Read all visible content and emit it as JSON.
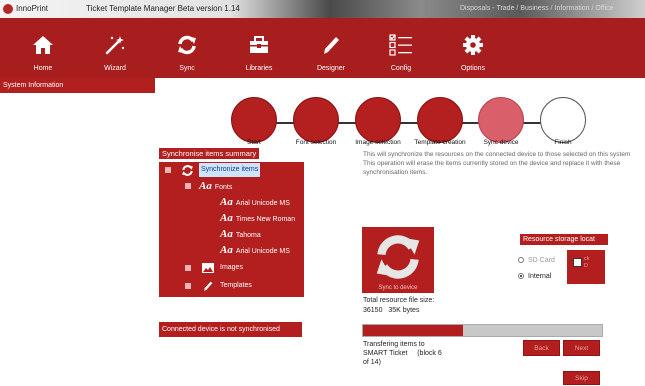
{
  "window": {
    "app_name": "InnoPrint",
    "title": "Ticket Template Manager Beta version 1.14",
    "blurred_right": "Disposals - Trade / Business / Information / Office"
  },
  "toolbar": {
    "items": [
      {
        "label": "Home",
        "icon": "home-icon"
      },
      {
        "label": "Wizard",
        "icon": "wand-icon"
      },
      {
        "label": "Sync",
        "icon": "sync-icon"
      },
      {
        "label": "Libraries",
        "icon": "toolbox-icon"
      },
      {
        "label": "Designer",
        "icon": "pen-icon"
      },
      {
        "label": "Config",
        "icon": "checklist-icon"
      },
      {
        "label": "Options",
        "icon": "gear-icon"
      }
    ]
  },
  "system_info": "System Information",
  "steps": [
    {
      "label": "Start",
      "state": "done"
    },
    {
      "label": "Font selection",
      "state": "done"
    },
    {
      "label": "Image selection",
      "state": "done"
    },
    {
      "label": "Template creation",
      "state": "done"
    },
    {
      "label": "Sync device",
      "state": "current"
    },
    {
      "label": "Finish",
      "state": "pending"
    }
  ],
  "summary": {
    "title": "Synchronise items summary",
    "root": "Synchronize items",
    "fonts": "Fonts",
    "font_items": [
      "Arial Unicode MS",
      "Times New Roman",
      "Tahoma",
      "Arial Unicode MS"
    ],
    "images": "Images",
    "templates": "Templates"
  },
  "description": {
    "line1": "This will synchronize the resources on the connected device to those selected on this system",
    "line2": "This operation will erase the items currently stored on the device and replace it with these synchronisation items."
  },
  "status": "Connected device is not synchronised",
  "sync_button": {
    "caption": "Sync to device"
  },
  "resource": {
    "size_label": "Total resource file size:",
    "size_value": "36150",
    "size_unit": "35K bytes"
  },
  "progress": {
    "fraction": 0.42
  },
  "transfer": {
    "line1": "Transfering items to",
    "line2": "SMART Ticket",
    "block": "(block 6",
    "line3": "of 14)"
  },
  "buttons": {
    "back": "Back",
    "next": "Next",
    "skip": "Skip"
  },
  "storage": {
    "title": "Resource storage locat",
    "sd_card": "SD Card",
    "internal": "Internal",
    "selected": "Internal",
    "box_text_1": "ck",
    "box_text_2": "D"
  },
  "colors": {
    "brand_red": "#b31f1f",
    "toolbar_red": "#a81e1e",
    "current_step": "#d9606a"
  }
}
